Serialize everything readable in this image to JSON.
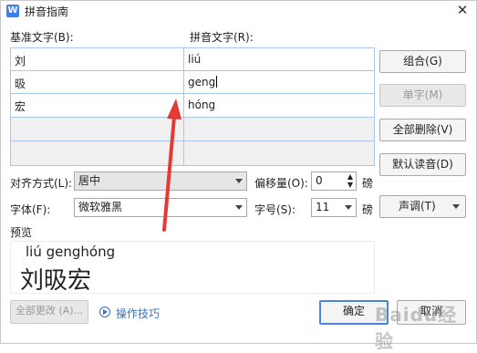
{
  "window": {
    "title": "拼音指南",
    "app_icon_letter": "W",
    "close_glyph": "✕"
  },
  "labels": {
    "base_text": "基准文字(B):",
    "pinyin_text": "拼音文字(R):"
  },
  "rows": [
    {
      "base": "刘",
      "pinyin": "liú"
    },
    {
      "base": "昅",
      "pinyin": "geng"
    },
    {
      "base": "宏",
      "pinyin": "hóng"
    },
    {
      "base": "",
      "pinyin": ""
    },
    {
      "base": "",
      "pinyin": ""
    }
  ],
  "side_buttons": {
    "combine": "组合(G)",
    "single": "单字(M)",
    "delete_all": "全部删除(V)",
    "default_reading": "默认读音(D)",
    "tone": "声调(T)"
  },
  "options": {
    "align_label": "对齐方式(L):",
    "align_value": "居中",
    "offset_label": "偏移量(O):",
    "offset_value": "0",
    "offset_unit": "磅",
    "font_label": "字体(F):",
    "font_value": "微软雅黑",
    "size_label": "字号(S):",
    "size_value": "11",
    "size_unit": "磅"
  },
  "preview": {
    "label": "预览",
    "pinyin": "liú genghóng",
    "hanzi": "刘昅宏"
  },
  "footer": {
    "apply_all": "全部更改 (A)...",
    "tips": "操作技巧",
    "ok": "确定",
    "cancel": "取消"
  },
  "watermark": "Baidu经验",
  "colors": {
    "accent": "#4a86d8",
    "link": "#3a6fc4",
    "grid": "#a9c7e8",
    "annotation_arrow": "#e53935"
  }
}
